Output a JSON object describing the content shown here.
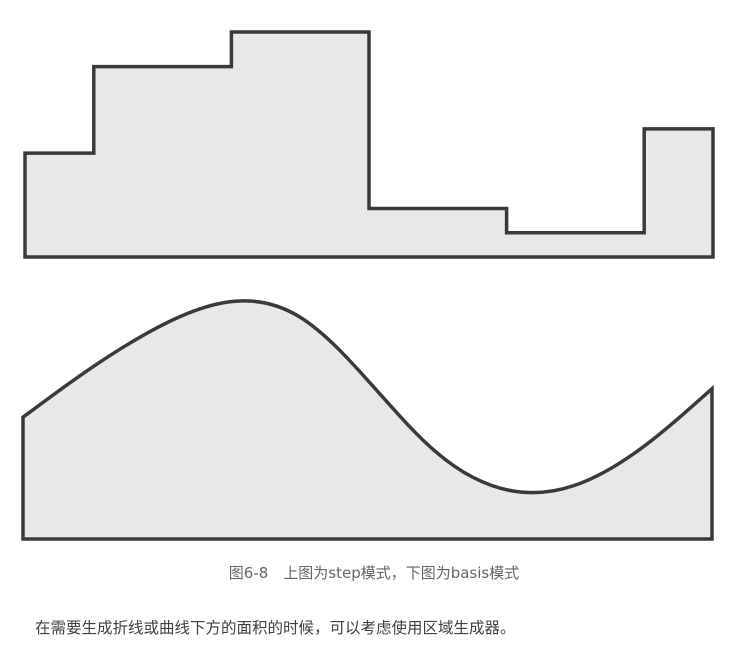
{
  "chart_data": [
    {
      "type": "area",
      "name": "step",
      "x": [
        0,
        1,
        2,
        3,
        4,
        5
      ],
      "y": [
        0.3,
        0.55,
        0.65,
        0.14,
        0.07,
        0.37
      ],
      "ylim": [
        0,
        0.65
      ],
      "curve": "step",
      "fill": "#e8e8e8",
      "stroke": "#3a3a3a"
    },
    {
      "type": "area",
      "name": "basis",
      "x": [
        0,
        1,
        2,
        3,
        4,
        5
      ],
      "y": [
        0.3,
        0.55,
        0.65,
        0.14,
        0.07,
        0.37
      ],
      "ylim": [
        0,
        0.65
      ],
      "curve": "basis",
      "fill": "#e8e8e8",
      "stroke": "#3a3a3a"
    }
  ],
  "caption": "图6-8　上图为step模式，下图为basis模式",
  "paragraph": "在需要生成折线或曲线下方的面积的时候，可以考虑使用区域生成器。"
}
